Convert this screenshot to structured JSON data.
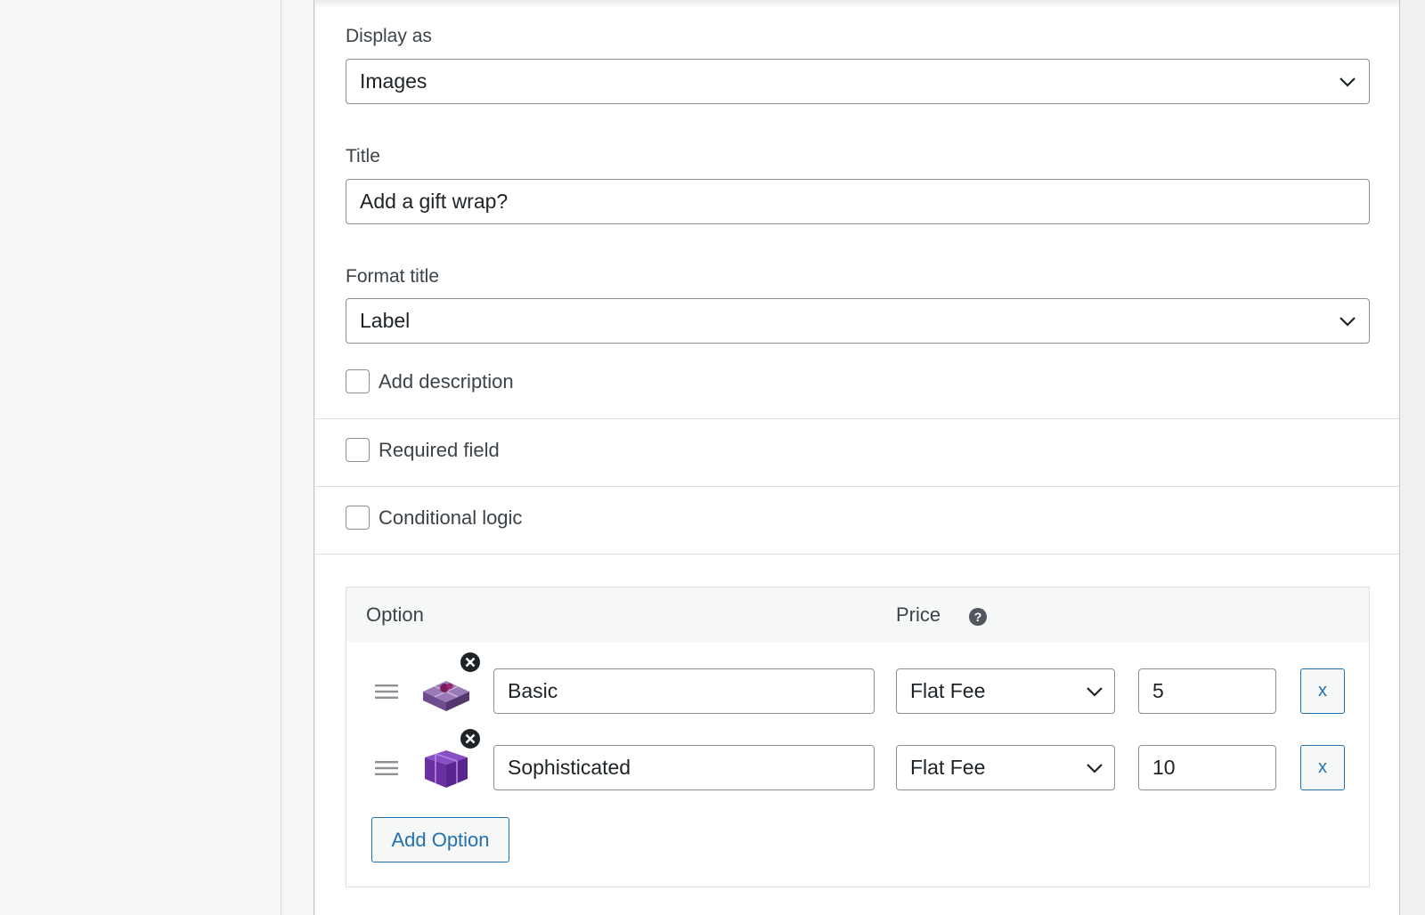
{
  "display_as": {
    "label": "Display as",
    "value": "Images"
  },
  "title_field": {
    "label": "Title",
    "value": "Add a gift wrap?"
  },
  "format_title": {
    "label": "Format title",
    "value": "Label"
  },
  "checkboxes": {
    "add_description": "Add description",
    "required_field": "Required field",
    "conditional_logic": "Conditional logic"
  },
  "options": {
    "header_option": "Option",
    "header_price": "Price",
    "help_glyph": "?",
    "rows": [
      {
        "name": "Basic",
        "price_type": "Flat Fee",
        "price": "5",
        "remove_label": "x"
      },
      {
        "name": "Sophisticated",
        "price_type": "Flat Fee",
        "price": "10",
        "remove_label": "x"
      }
    ],
    "add_button": "Add Option"
  },
  "colors": {
    "accent": "#2271b1",
    "border": "#8c8f94",
    "gift_purple": "#6b2fa3"
  },
  "icons": [
    "chevron-down-icon",
    "question-circle-icon",
    "drag-handle-icon",
    "remove-image-icon",
    "gift-box-image"
  ]
}
